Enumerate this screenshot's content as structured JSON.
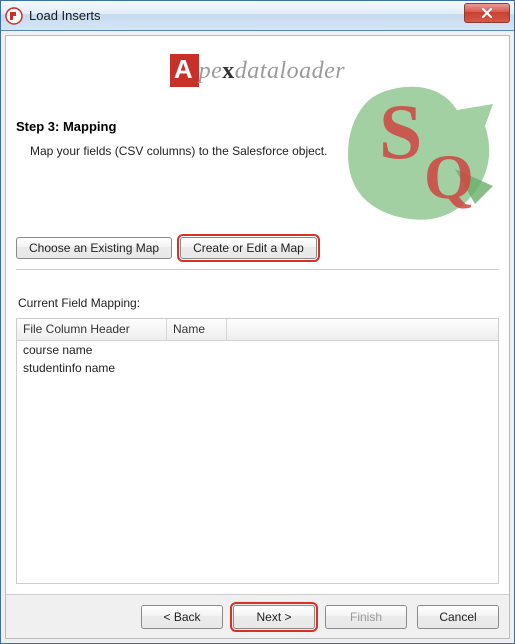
{
  "window": {
    "title": "Load Inserts"
  },
  "logo": {
    "a": "A",
    "pe": "pe",
    "x": "x",
    "rest": "dataloader"
  },
  "header": {
    "step_title": "Step 3: Mapping",
    "step_desc": "Map your fields (CSV columns) to the Salesforce object."
  },
  "buttons": {
    "choose_map": "Choose an Existing Map",
    "create_map": "Create or Edit a Map"
  },
  "mapping": {
    "label": "Current Field Mapping:",
    "columns": {
      "col1": "File Column Header",
      "col2": "Name"
    },
    "rows": [
      {
        "col1": "course name",
        "col2": ""
      },
      {
        "col1": "studentinfo name",
        "col2": ""
      }
    ]
  },
  "footer": {
    "back": "< Back",
    "next": "Next >",
    "finish": "Finish",
    "cancel": "Cancel"
  }
}
